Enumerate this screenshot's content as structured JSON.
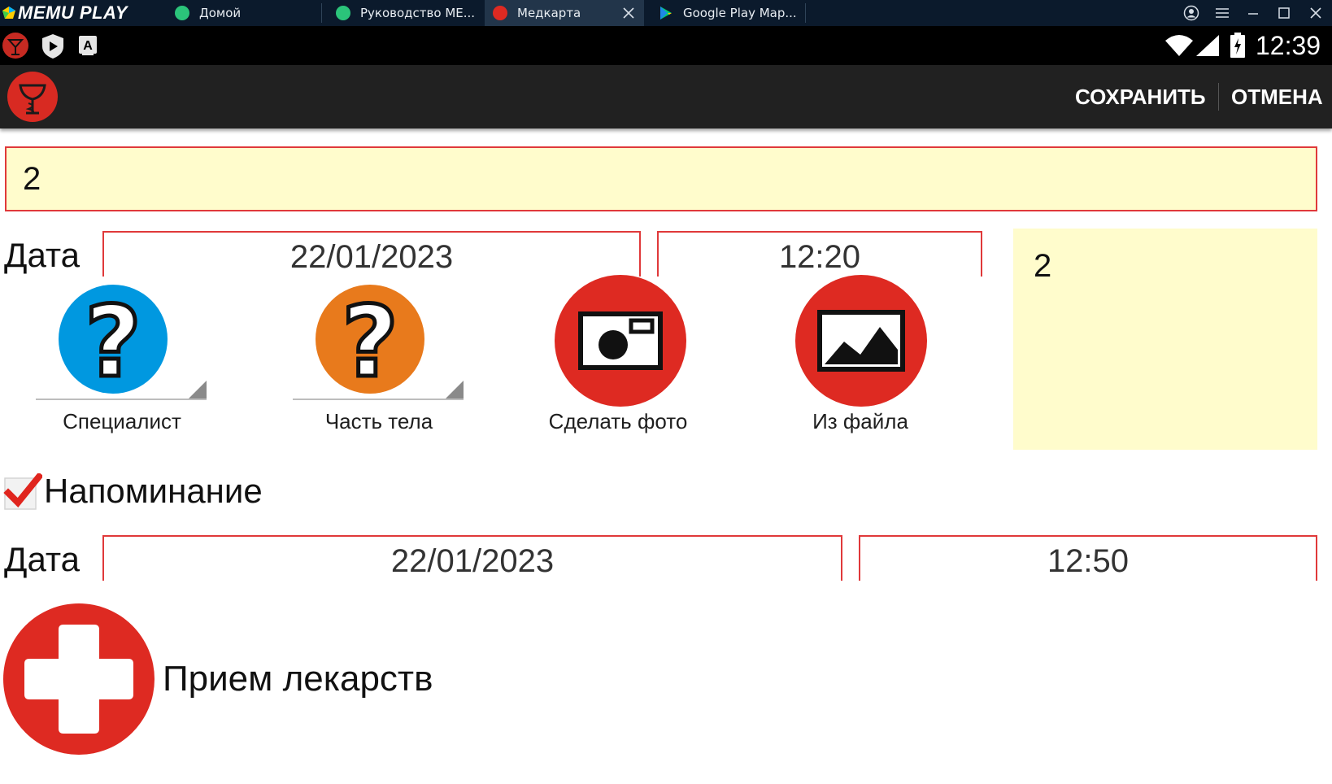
{
  "window": {
    "app_logo": "MEMU PLAY",
    "tabs": [
      {
        "label": "Домой",
        "icon": "home-app-icon",
        "active": false
      },
      {
        "label": "Руководство МЕ...",
        "icon": "help-app-icon",
        "active": false
      },
      {
        "label": "Медкарта",
        "icon": "medcard-app-icon",
        "active": true
      },
      {
        "label": "Google Play Map...",
        "icon": "google-play-icon",
        "active": false
      }
    ]
  },
  "statusbar": {
    "time": "12:39",
    "icons": [
      "medcard-notification-icon",
      "play-protect-icon",
      "keyboard-a-icon",
      "wifi-icon",
      "signal-icon",
      "battery-icon"
    ]
  },
  "actionbar": {
    "save_label": "СОХРАНИТЬ",
    "cancel_label": "ОТМЕНА"
  },
  "form": {
    "title_value": "2",
    "date_label": "Дата",
    "date_value": "22/01/2023",
    "time_value": "12:20",
    "note_value": "2",
    "buttons": [
      {
        "label": "Специалист",
        "icon": "question-icon"
      },
      {
        "label": "Часть тела",
        "icon": "question-icon"
      },
      {
        "label": "Сделать фото",
        "icon": "camera-icon"
      },
      {
        "label": "Из файла",
        "icon": "image-icon"
      }
    ],
    "reminder": {
      "label": "Напоминание",
      "checked": true,
      "date_label": "Дата",
      "date_value": "22/01/2023",
      "time_value": "12:50"
    },
    "medication": {
      "label": "Прием лекарств",
      "icon": "add-cross-icon"
    }
  },
  "colors": {
    "accent_red": "#de2a22",
    "field_border": "#e0393a",
    "field_fill": "#fffccc",
    "blue": "#0098e0",
    "orange": "#e87a1c",
    "toolbar": "#212121"
  }
}
